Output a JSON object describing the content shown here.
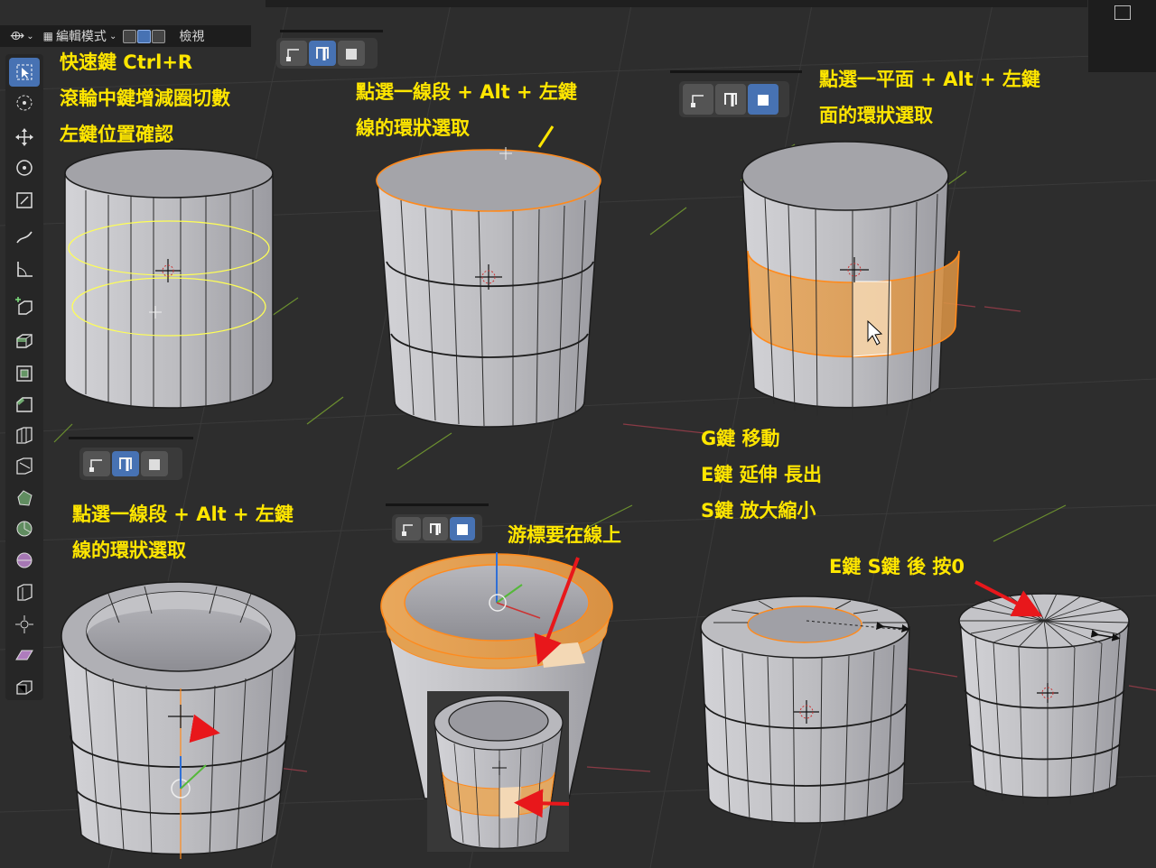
{
  "header": {
    "cursor_tool_icon": "transform-pivot-icon",
    "mode_icon": "edit-mode-icon",
    "mode_label": "編輯模式",
    "select_modes": [
      "vertex-select-icon",
      "edge-select-icon",
      "face-select-icon"
    ],
    "view_menu": "檢視"
  },
  "toolbar": {
    "tools": [
      "select-box-icon",
      "cursor-icon",
      "move-icon",
      "rotate-icon",
      "scale-icon",
      "annotate-icon",
      "measure-icon",
      "add-cube-icon",
      "extrude-icon",
      "inset-icon",
      "bevel-icon",
      "loop-cut-icon",
      "knife-icon",
      "poly-build-icon",
      "spin-icon",
      "smooth-icon",
      "edge-slide-icon",
      "shrink-fatten-icon",
      "shear-icon",
      "rip-icon"
    ]
  },
  "panels": {
    "p1": {
      "lines": [
        "快速鍵 Ctrl+R",
        "滾輪中鍵增減圈切數",
        "左鍵位置確認"
      ]
    },
    "p2": {
      "lines": [
        "點選一線段 + Alt + 左鍵",
        "線的環狀選取"
      ]
    },
    "p3": {
      "lines": [
        "點選一平面 + Alt + 左鍵",
        "面的環狀選取"
      ]
    },
    "p4": {
      "lines": [
        "點選一線段 + Alt + 左鍵",
        "線的環狀選取"
      ]
    },
    "p5": {
      "lines": [
        "游標要在線上"
      ]
    },
    "p6": {
      "lines": [
        "G鍵 移動",
        "E鍵  延伸 長出",
        "S鍵  放大縮小"
      ]
    },
    "p7": {
      "lines": [
        "E鍵 S鍵 後 按0"
      ]
    }
  },
  "colors": {
    "label": "#ffe600",
    "background": "#2d2d2d",
    "mesh_face": "#b9b9bd",
    "mesh_edge": "#1c1c1c",
    "selected_face": "#e8a64c",
    "selected_edge": "#ff8a1c",
    "active_button": "#4772b3",
    "arrow": "#e8171b",
    "loop_cut": "#ffff66"
  }
}
